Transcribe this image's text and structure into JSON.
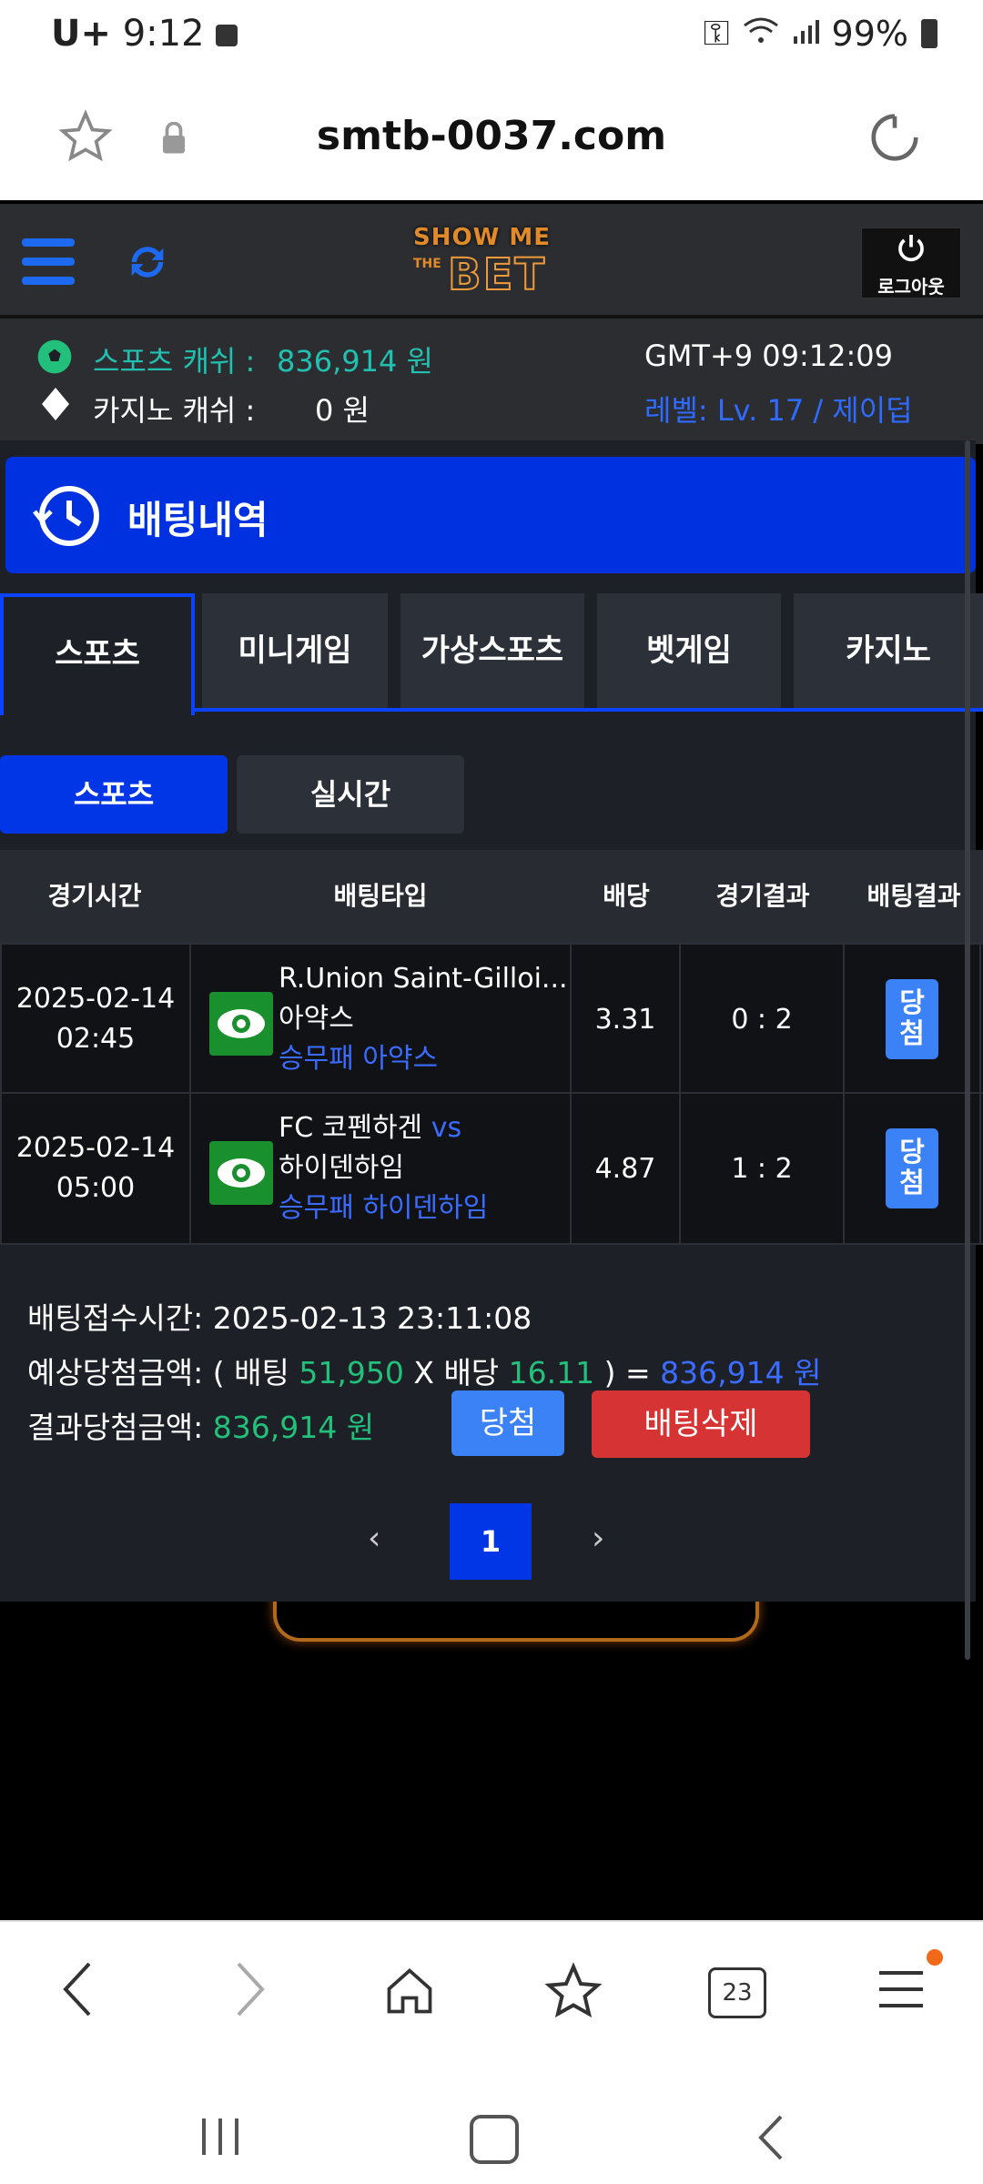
{
  "status": {
    "carrier": "U+",
    "time": "9:12",
    "battery": "99%"
  },
  "browser": {
    "url": "smtb-0037.com",
    "tabs_count": "23"
  },
  "site": {
    "logo_top": "SHOW ME",
    "logo_mid": "THE",
    "logo_bottom": "BET",
    "logout": "로그아웃"
  },
  "info": {
    "sports_cash_label": "스포츠 캐쉬 :",
    "sports_cash_value": "836,914 원",
    "casino_cash_label": "카지노 캐쉬 :",
    "casino_cash_value": "0 원",
    "gmt": "GMT+9 09:12:09",
    "level": "레벨: Lv. 17 / 제이덥"
  },
  "page": {
    "title": "배팅내역"
  },
  "tabs": [
    "스포츠",
    "미니게임",
    "가상스포츠",
    "벳게임",
    "카지노"
  ],
  "subtabs": [
    "스포츠",
    "실시간"
  ],
  "table": {
    "headers": [
      "경기시간",
      "배팅타입",
      "배당",
      "경기결과",
      "배팅결과"
    ],
    "rows": [
      {
        "date": "2025-02-14",
        "time": "02:45",
        "home": "R.Union Saint-Gilloi...",
        "vs": "",
        "away": "아약스",
        "pick": "승무패 아약스",
        "odds": "3.31",
        "score": "0 : 2",
        "result": "당첨"
      },
      {
        "date": "2025-02-14",
        "time": "05:00",
        "home": "FC 코펜하겐",
        "vs": "vs",
        "away": "하이덴하임",
        "pick": "승무패 하이덴하임",
        "odds": "4.87",
        "score": "1 : 2",
        "result": "당첨"
      }
    ]
  },
  "summary": {
    "accept_label": "배팅접수시간:",
    "accept_value": "2025-02-13 23:11:08",
    "expected_label": "예상당첨금액:",
    "open_paren": "( 배팅",
    "stake": "51,950",
    "times": "X 배당",
    "total_odds": "16.11",
    "close_paren": ") =",
    "expected_value": "836,914 원",
    "result_label": "결과당첨금액:",
    "result_value": "836,914 원",
    "win_button": "당첨",
    "delete_button": "배팅삭제"
  },
  "pagination": {
    "current": "1"
  },
  "colors": {
    "accent_blue": "#0031e0",
    "green": "#22c07a",
    "link_blue": "#3b6cff",
    "delete_red": "#d63434"
  }
}
